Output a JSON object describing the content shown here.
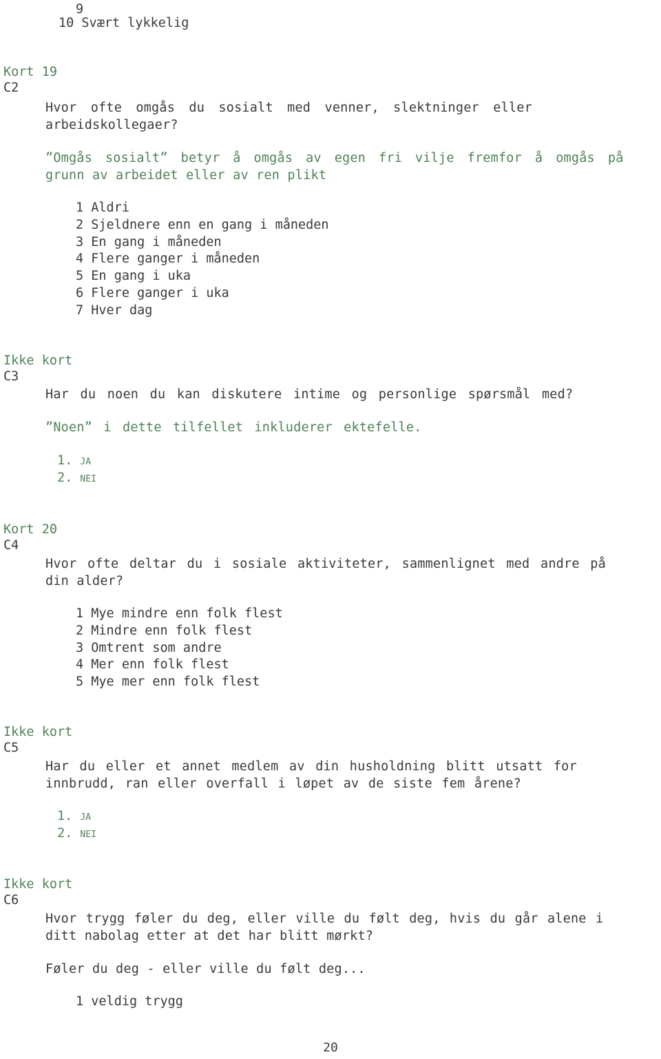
{
  "document": {
    "page_number": "20",
    "colors": {
      "green": "#4f8257",
      "text": "#3b3b3b",
      "background": "#ffffff"
    }
  },
  "carryover": {
    "scale_item_9": "9",
    "scale_item_10": "10 Svært lykkelig"
  },
  "sections": [
    {
      "id": "C2",
      "card_label": "Kort 19",
      "code": "C2",
      "question_lines": [
        "Hvor ofte omgås du sosialt med venner, slektninger eller",
        "arbeidskollegaer?"
      ],
      "note_lines": [
        "”Omgås sosialt” betyr å omgås av egen fri vilje fremfor å omgås på",
        "grunn av arbeidet eller av ren plikt"
      ],
      "options": [
        "1 Aldri",
        "2 Sjeldnere enn en gang i måneden",
        "3 En gang i måneden",
        "4 Flere ganger i måneden",
        "5 En gang i uka",
        "6 Flere ganger i uka",
        "7 Hver dag"
      ]
    },
    {
      "id": "C3",
      "card_label": "Ikke kort",
      "code": "C3",
      "question_lines": [
        "Har du noen du kan diskutere intime og personlige spørsmål med?"
      ],
      "note_lines": [
        "”Noen” i dette tilfellet inkluderer ektefelle."
      ],
      "options": [
        "1. Ja",
        "2. Nei"
      ]
    },
    {
      "id": "C4",
      "card_label": "Kort 20",
      "code": "C4",
      "question_lines": [
        "Hvor ofte deltar du i sosiale aktiviteter, sammenlignet med andre på",
        "din alder?"
      ],
      "note_lines": [],
      "options": [
        "1 Mye mindre enn folk flest",
        "2 Mindre enn folk flest",
        "3 Omtrent som andre",
        "4 Mer enn folk flest",
        "5 Mye mer enn folk flest"
      ]
    },
    {
      "id": "C5",
      "card_label": "Ikke kort",
      "code": "C5",
      "question_lines": [
        "Har du eller et annet medlem av din husholdning blitt utsatt for",
        "innbrudd, ran eller overfall i løpet av de siste fem årene?"
      ],
      "note_lines": [],
      "options": [
        "1. Ja",
        "2. Nei"
      ]
    },
    {
      "id": "C6",
      "card_label": "Ikke kort",
      "code": "C6",
      "question_lines": [
        "Hvor trygg føler du deg, eller ville du følt deg, hvis du går alene i",
        "ditt nabolag etter at det har blitt mørkt?"
      ],
      "sub_prompt": "Føler du deg - eller ville du følt deg...",
      "note_lines": [],
      "options": [
        "1 veldig trygg"
      ]
    }
  ]
}
